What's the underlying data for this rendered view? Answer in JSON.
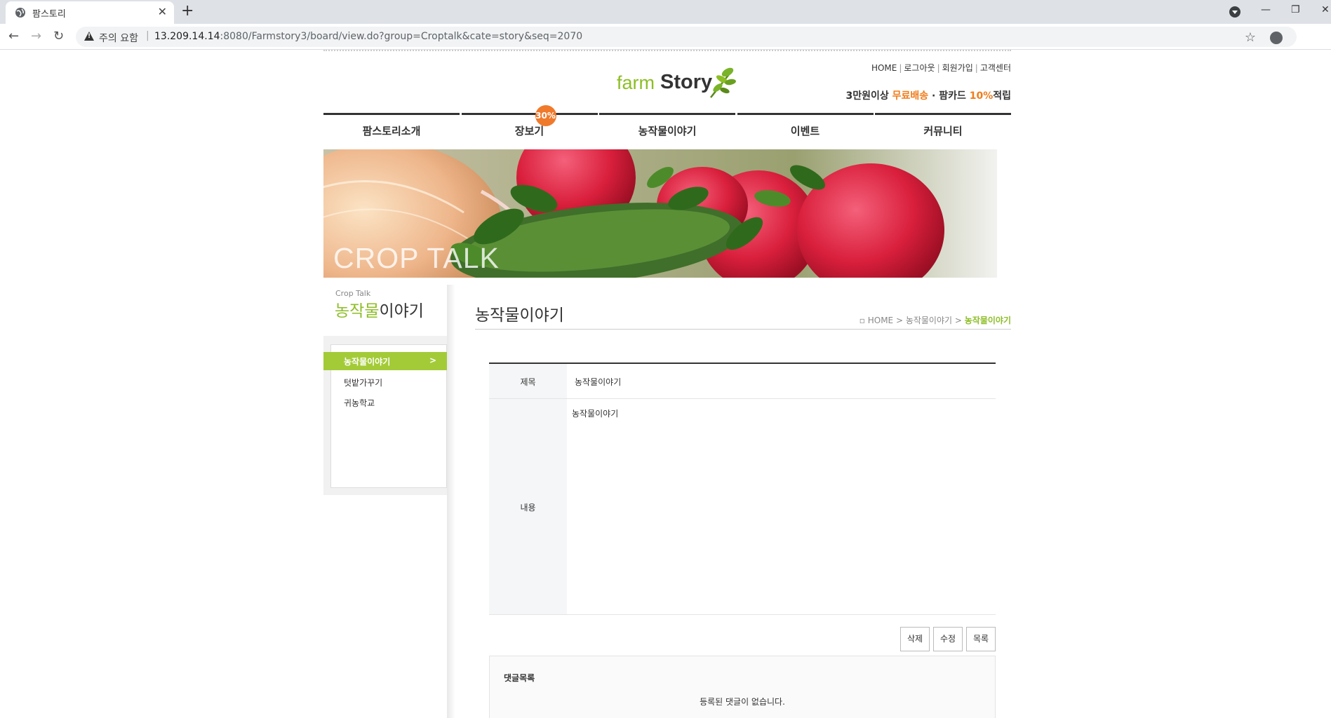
{
  "browser": {
    "tab_title": "팜스토리",
    "warning_label": "주의 요함",
    "url_host": "13.209.14.14",
    "url_path": ":8080/Farmstory3/board/view.do?group=Croptalk&cate=story&seq=2070"
  },
  "header": {
    "util_links": [
      "HOME",
      "로그아웃",
      "회원가입",
      "고객센터"
    ],
    "logo_farm": "farm",
    "logo_story": "Story",
    "promo_prefix": "3만원이상 ",
    "promo_free": "무료배송",
    "promo_mid": " · 팜카드 ",
    "promo_pct": "10%",
    "promo_suffix": "적립"
  },
  "gnb": {
    "items": [
      "팜스토리소개",
      "장보기",
      "농작물이야기",
      "이벤트",
      "커뮤니티"
    ],
    "badge": "30%"
  },
  "banner": {
    "title": "CROP TALK"
  },
  "aside": {
    "sub": "Crop Talk",
    "title_green": "농작물",
    "title_rest": "이야기",
    "items": [
      "농작물이야기",
      "텃밭가꾸기",
      "귀농학교"
    ],
    "active_chevron": ">"
  },
  "content": {
    "title": "농작물이야기",
    "breadcrumb_home": "HOME",
    "breadcrumb_mid": "농작물이야기",
    "breadcrumb_cur": "농작물이야기"
  },
  "board": {
    "title_label": "제목",
    "title_value": "농작물이야기",
    "body_label": "내용",
    "body_value": "농작물이야기"
  },
  "buttons": {
    "delete": "삭제",
    "edit": "수정",
    "list": "목록"
  },
  "comments": {
    "title": "댓글목록",
    "empty": "등록된 댓글이 없습니다."
  },
  "colors": {
    "accent_green": "#8dbe26",
    "accent_orange": "#ef7c1b"
  }
}
